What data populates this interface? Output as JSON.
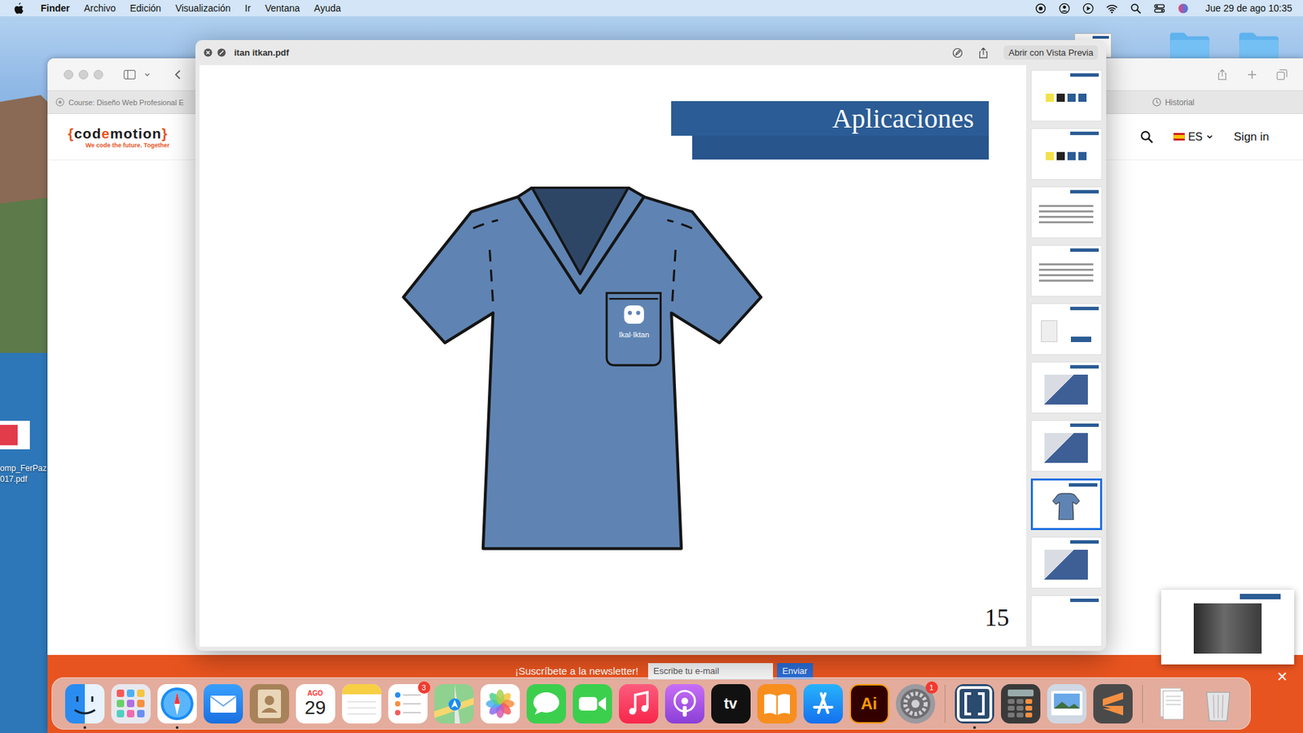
{
  "menubar": {
    "items": [
      {
        "label": "Finder",
        "bold": true
      },
      {
        "label": "Archivo",
        "bold": false
      },
      {
        "label": "Edición",
        "bold": false
      },
      {
        "label": "Visualización",
        "bold": false
      },
      {
        "label": "Ir",
        "bold": false
      },
      {
        "label": "Ventana",
        "bold": false
      },
      {
        "label": "Ayuda",
        "bold": false
      }
    ],
    "clock": "Jue 29 de ago 10:35"
  },
  "desktop": {
    "file": {
      "lines": [
        "omp_FerPaz",
        "017.pdf"
      ]
    }
  },
  "browser": {
    "tab": "Course: Diseño Web Profesional E",
    "history": "Historial",
    "logo": {
      "parts": [
        {
          "text": "{",
          "color": "#e8541f"
        },
        {
          "text": "cod",
          "color": "#1d1d1d"
        },
        {
          "text": "e",
          "color": "#e8541f"
        },
        {
          "text": "motion",
          "color": "#1d1d1d"
        },
        {
          "text": "}",
          "color": "#e8541f"
        }
      ],
      "tagline": "We code the future. Together"
    },
    "language": "ES",
    "sign_in": "Sign in",
    "newsletter": {
      "title": "¡Suscríbete a la newsletter!",
      "placeholder": "Escribe tu e-mail",
      "button": "Enviar",
      "close": "✕"
    }
  },
  "quicklook": {
    "title": "itan itkan.pdf",
    "open_button": "Abrir con Vista Previa",
    "page": {
      "heading": "Aplicaciones",
      "number": "15",
      "pocket_logo": "Ikal·Iktan"
    },
    "thumbnails": [
      {
        "kind": "logos",
        "selected": false
      },
      {
        "kind": "logos",
        "selected": false
      },
      {
        "kind": "text",
        "selected": false
      },
      {
        "kind": "text",
        "selected": false
      },
      {
        "kind": "stationery",
        "selected": false
      },
      {
        "kind": "photo",
        "selected": false
      },
      {
        "kind": "photo",
        "selected": false
      },
      {
        "kind": "shirt",
        "selected": true
      },
      {
        "kind": "photo",
        "selected": false
      },
      {
        "kind": "blank",
        "selected": false
      }
    ]
  },
  "dock": {
    "items": [
      {
        "kind": "finder",
        "running": true
      },
      {
        "kind": "launchpad",
        "running": false
      },
      {
        "kind": "safari",
        "running": true
      },
      {
        "kind": "mail",
        "running": false
      },
      {
        "kind": "contacts",
        "running": false
      },
      {
        "kind": "calendar",
        "running": false,
        "month": "AGO",
        "day": "29"
      },
      {
        "kind": "notes",
        "running": false
      },
      {
        "kind": "reminders",
        "running": false,
        "badge": "3"
      },
      {
        "kind": "maps",
        "running": false
      },
      {
        "kind": "photos",
        "running": false
      },
      {
        "kind": "messages",
        "running": false
      },
      {
        "kind": "facetime",
        "running": false
      },
      {
        "kind": "music",
        "running": false
      },
      {
        "kind": "podcasts",
        "running": false
      },
      {
        "kind": "tv",
        "running": false,
        "label": "tv"
      },
      {
        "kind": "books",
        "running": false
      },
      {
        "kind": "appstore",
        "running": false
      },
      {
        "kind": "illustrator",
        "running": false,
        "label": "Ai"
      },
      {
        "kind": "settings",
        "running": false,
        "badge": "1"
      },
      {
        "kind": "separator"
      },
      {
        "kind": "brackets",
        "running": true
      },
      {
        "kind": "calculator",
        "running": false
      },
      {
        "kind": "preview",
        "running": false
      },
      {
        "kind": "sublime",
        "running": false
      },
      {
        "kind": "separator"
      },
      {
        "kind": "documents",
        "running": false
      },
      {
        "kind": "trash",
        "running": false
      }
    ]
  }
}
